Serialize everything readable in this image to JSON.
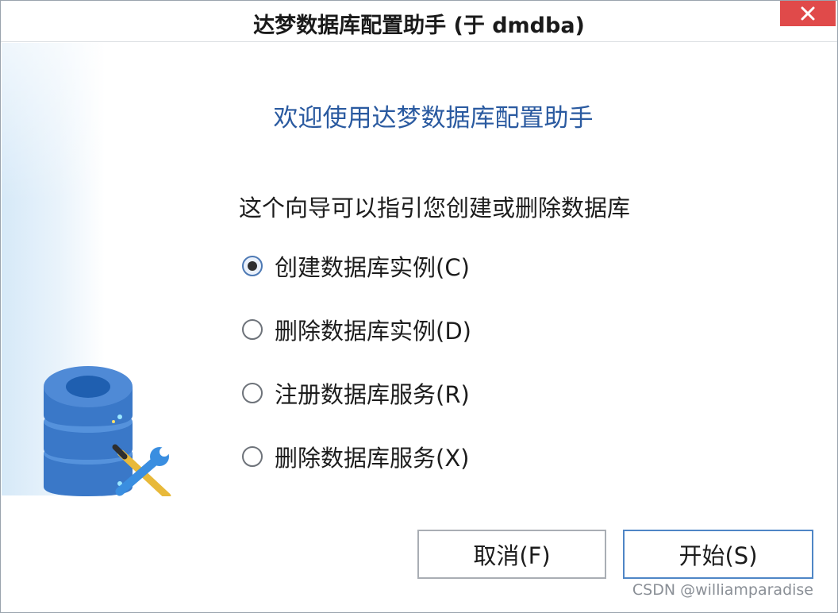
{
  "window": {
    "title": "达梦数据库配置助手 (于 dmdba)",
    "close_icon": "close-icon"
  },
  "main": {
    "welcome": "欢迎使用达梦数据库配置助手",
    "guide": "这个向导可以指引您创建或删除数据库",
    "options": [
      {
        "label": "创建数据库实例(C)",
        "checked": true
      },
      {
        "label": "删除数据库实例(D)",
        "checked": false
      },
      {
        "label": "注册数据库服务(R)",
        "checked": false
      },
      {
        "label": "删除数据库服务(X)",
        "checked": false
      }
    ]
  },
  "buttons": {
    "cancel": "取消(F)",
    "start": "开始(S)"
  },
  "watermark": "CSDN @williamparadise",
  "colors": {
    "accent": "#2a5aa0",
    "close": "#e04a4a",
    "primary_border": "#4f86c6"
  }
}
